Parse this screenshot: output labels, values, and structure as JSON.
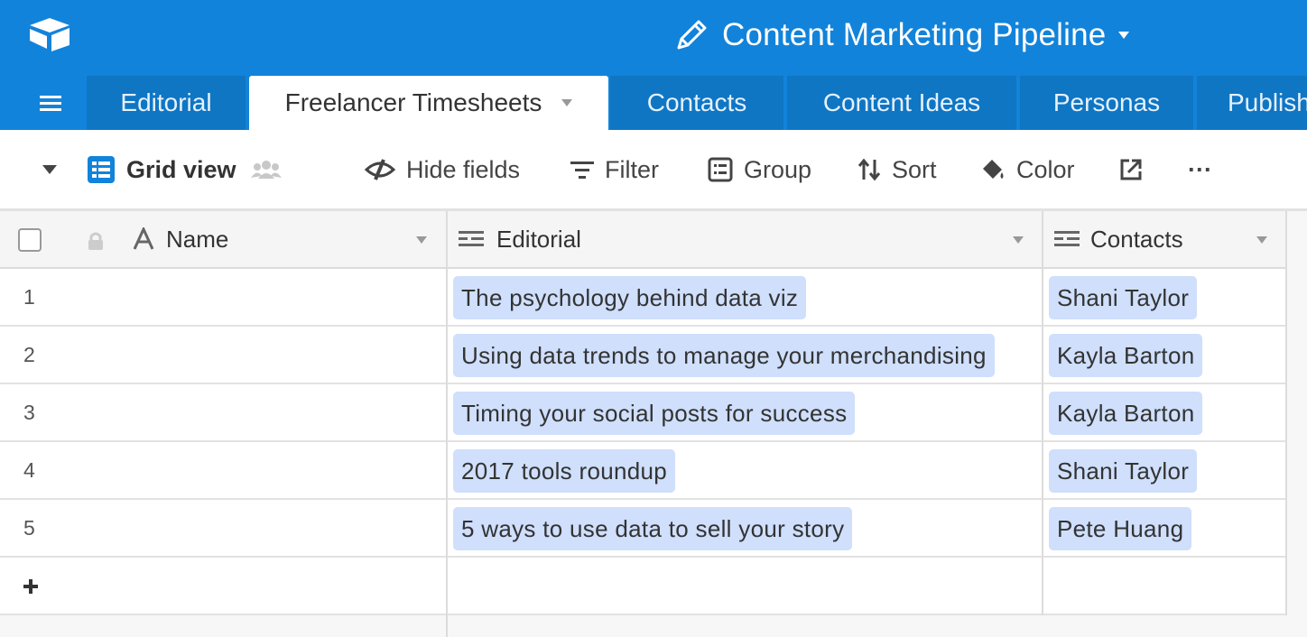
{
  "app": {
    "base_title": "Content Marketing Pipeline",
    "brand_color": "#1283da",
    "icons": {
      "logo": "airtable-logo-icon",
      "edit": "pencil-icon",
      "title_menu": "caret-down-icon",
      "menu": "hamburger-icon"
    }
  },
  "tabs": [
    {
      "label": "Editorial",
      "active": false
    },
    {
      "label": "Freelancer Timesheets",
      "active": true
    },
    {
      "label": "Contacts",
      "active": false
    },
    {
      "label": "Content Ideas",
      "active": false
    },
    {
      "label": "Personas",
      "active": false
    },
    {
      "label": "Publish",
      "active": false
    }
  ],
  "toolbar": {
    "view_name": "Grid view",
    "hide_fields": "Hide fields",
    "filter": "Filter",
    "group": "Group",
    "sort": "Sort",
    "color": "Color",
    "more": "···"
  },
  "columns": [
    {
      "label": "Name",
      "type": "single-line-text"
    },
    {
      "label": "Editorial",
      "type": "linked-record"
    },
    {
      "label": "Contacts",
      "type": "linked-record"
    }
  ],
  "rows": [
    {
      "num": "1",
      "name": "",
      "editorial": "The psychology behind data viz",
      "contact": "Shani Taylor"
    },
    {
      "num": "2",
      "name": "",
      "editorial": "Using data trends to manage your merchandising",
      "contact": "Kayla Barton"
    },
    {
      "num": "3",
      "name": "",
      "editorial": "Timing your social posts for success",
      "contact": "Kayla Barton"
    },
    {
      "num": "4",
      "name": "",
      "editorial": "2017 tools roundup",
      "contact": "Shani Taylor"
    },
    {
      "num": "5",
      "name": "",
      "editorial": "5 ways to use data to sell your story",
      "contact": "Pete Huang"
    }
  ],
  "add_row_label": "+",
  "colors": {
    "chip": "#cfdffc",
    "tab_inactive": "#0f76c4",
    "grid_icon": "#1283da"
  }
}
